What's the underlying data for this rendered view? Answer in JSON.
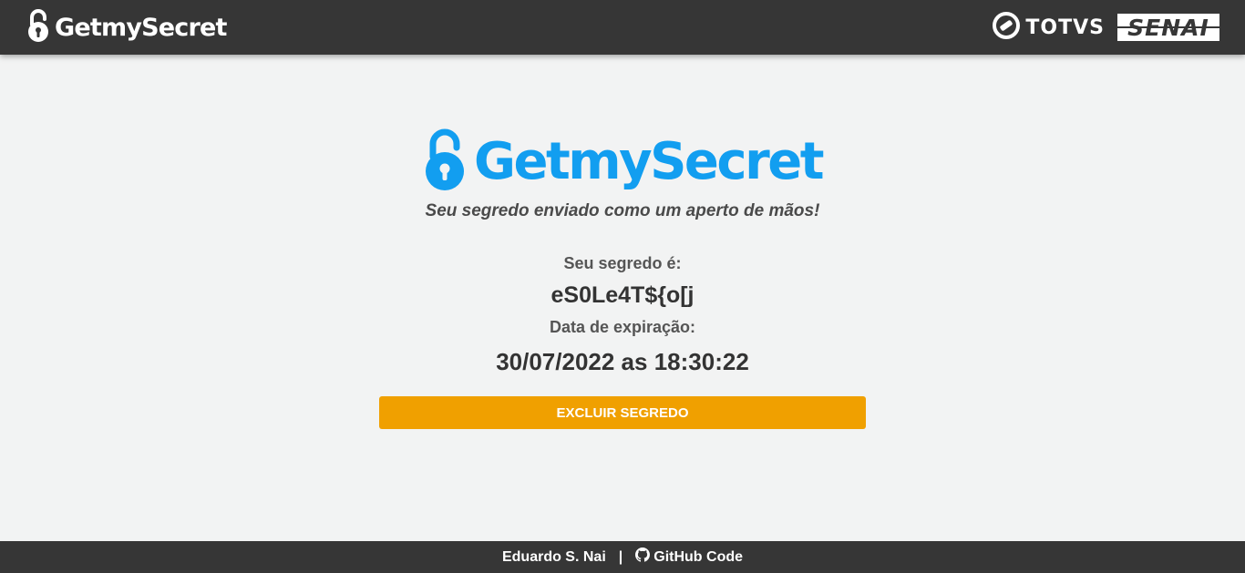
{
  "header": {
    "brand": "GetmySecret",
    "partners": {
      "totvs": "TOTVS",
      "senai": "SENAI"
    }
  },
  "main": {
    "logo_text": "GetmySecret",
    "tagline": "Seu segredo enviado como um aperto de mãos!",
    "secret_label": "Seu segredo é:",
    "secret_value": "eS0Le4T${o[j",
    "expiration_label": "Data de expiração:",
    "expiration_value": "30/07/2022 as 18:30:22",
    "delete_button": "EXCLUIR SEGREDO"
  },
  "footer": {
    "author": "Eduardo S. Nai",
    "separator": "|",
    "github_label": "GitHub Code"
  },
  "colors": {
    "header_bg": "#363636",
    "brand_blue": "#129ef0",
    "button_orange": "#f0a000",
    "page_bg": "#f2f3f3"
  },
  "icons": {
    "brand": "unlocked-padlock-icon",
    "totvs": "totvs-logo-icon",
    "github": "github-icon"
  }
}
